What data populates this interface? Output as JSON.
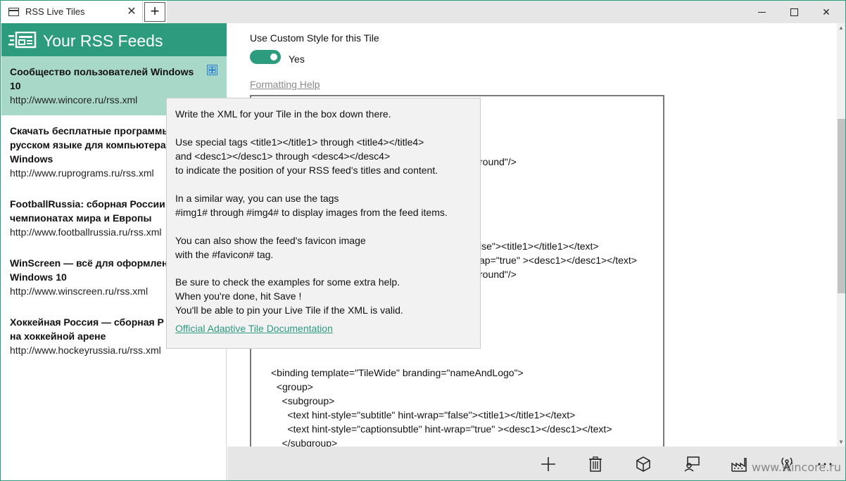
{
  "window": {
    "tab_title": "RSS Live Tiles",
    "tab_close": "✕",
    "new_tab": "+",
    "min_label": "",
    "max_label": "",
    "close_label": "✕"
  },
  "sidebar": {
    "title": "Your RSS Feeds",
    "feeds": [
      {
        "title_line1": "Сообщество пользователей Windows",
        "title_line2": "10",
        "url": "http://www.wincore.ru/rss.xml"
      },
      {
        "title_line1": "Скачать бесплатные программы",
        "title_line2": "русском языке для компьютера",
        "title_line3": "Windows",
        "url": "http://www.ruprograms.ru/rss.xml"
      },
      {
        "title_line1": "FootballRussia: сборная России",
        "title_line2": "чемпионатах мира и Европы",
        "url": "http://www.footballrussia.ru/rss.xml"
      },
      {
        "title_line1": "WinScreen — всё для оформлен",
        "title_line2": "Windows 10",
        "url": "http://www.winscreen.ru/rss.xml"
      },
      {
        "title_line1": "Хоккейная Россия — сборная Р",
        "title_line2": "на хоккейной арене",
        "url": "http://www.hockeyrussia.ru/rss.xml"
      }
    ]
  },
  "main": {
    "custom_style_label": "Use Custom Style for this Tile",
    "toggle_label": "Yes",
    "toggle_on": true,
    "formatting_help": "Formatting Help",
    "xml_partial_lines": [
      "round\"/>",
      "lse\"><title1></title1></text>",
      "ap=\"true\" ><desc1></desc1></text>",
      "round\"/>"
    ],
    "xml_lines": [
      "<binding template=\"TileWide\" branding=\"nameAndLogo\">",
      "  <group>",
      "    <subgroup>",
      "      <text hint-style=\"subtitle\" hint-wrap=\"false\"><title1></title1></text>",
      "      <text hint-style=\"captionsubtle\" hint-wrap=\"true\" ><desc1></desc1></text>",
      "    </subgroup>"
    ]
  },
  "tooltip": {
    "lines": [
      "Write the XML for your Tile in the box down there.",
      "Use special tags <title1></title1> through <title4></title4>",
      "and <desc1></desc1> through <desc4></desc4>",
      "to indicate the position of your RSS feed's titles and content.",
      "In a similar way, you can use the tags",
      "#img1# through #img4# to display images from the feed items.",
      "You can also show the feed's favicon image",
      "with the #favicon# tag.",
      "Be sure to check the examples for some extra help.",
      "When you're done, hit Save !",
      "You'll be able to pin your Live Tile if the XML is valid."
    ],
    "link": "Official Adaptive Tile Documentation"
  },
  "commands": [
    {
      "name": "add-icon"
    },
    {
      "name": "delete-icon"
    },
    {
      "name": "tile-preview-icon"
    },
    {
      "name": "feedback-icon"
    },
    {
      "name": "factory-icon"
    },
    {
      "name": "broadcast-icon"
    },
    {
      "name": "more-icon"
    }
  ],
  "watermark": "www.wincore.ru",
  "colors": {
    "accent": "#2d9b7e",
    "selected": "#a8d8c8",
    "link_gray": "#8a8a8a"
  }
}
